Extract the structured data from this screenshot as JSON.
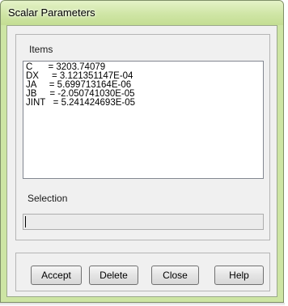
{
  "window": {
    "title": "Scalar Parameters"
  },
  "items": {
    "label": "Items",
    "rows": [
      "C      = 3203.74079",
      "DX     = 3.121351147E-04",
      "JA     = 5.699713164E-06",
      "JB     = -2.050741030E-05",
      "JINT   = 5.241424693E-05"
    ]
  },
  "selection": {
    "label": "Selection",
    "value": ""
  },
  "buttons": {
    "accept": "Accept",
    "delete": "Delete",
    "close": "Close",
    "help": "Help"
  }
}
